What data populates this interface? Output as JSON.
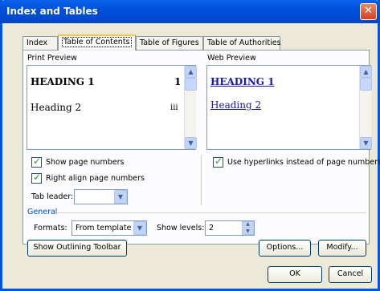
{
  "window": {
    "title": "Index and Tables",
    "close_glyph": "✕"
  },
  "tabs": [
    {
      "label": "Index",
      "key": "x"
    },
    {
      "label": "Table of Contents",
      "key": "C"
    },
    {
      "label": "Table of Figures",
      "key": "F"
    },
    {
      "label": "Table of Authorities",
      "key": "A"
    }
  ],
  "print_preview": {
    "label": "Print Preview",
    "heading1": "HEADING 1",
    "heading1_page": "1",
    "heading2": "Heading 2",
    "heading2_page": "iii"
  },
  "web_preview": {
    "label": "Web Preview",
    "heading1": "HEADING 1",
    "heading2": "Heading 2"
  },
  "options": {
    "show_page_numbers": {
      "label": "Show page numbers",
      "checked": true
    },
    "right_align": {
      "label": "Right align page numbers",
      "checked": true
    },
    "use_hyperlinks": {
      "label": "Use hyperlinks instead of page numbers",
      "checked": true
    },
    "tab_leader": {
      "label": "Tab leader:",
      "value": ""
    }
  },
  "general": {
    "label": "General",
    "formats_label": "Formats:",
    "formats_value": "From template",
    "show_levels_label": "Show levels:",
    "show_levels_value": "2"
  },
  "buttons": {
    "outlining": "Show Outlining Toolbar",
    "options": "Options...",
    "modify": "Modify...",
    "ok": "OK",
    "cancel": "Cancel"
  },
  "colors": {
    "title_bar": "#0054e3",
    "close": "#d4401f",
    "link": "#1a1aa6",
    "check": "#21a121",
    "active_tab_accent": "#ffc83c"
  }
}
